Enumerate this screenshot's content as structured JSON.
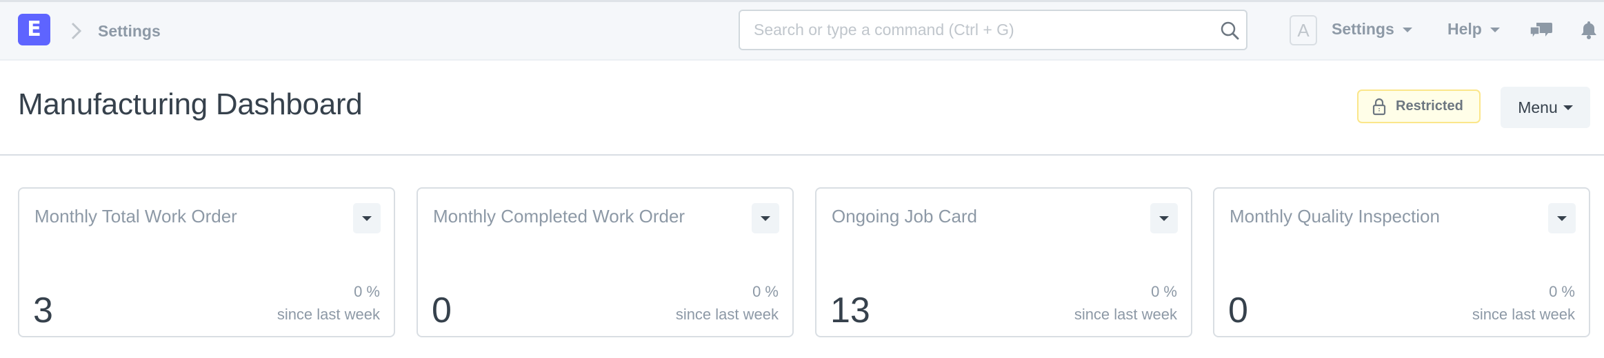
{
  "navbar": {
    "logo_letter": "E",
    "breadcrumb": "Settings",
    "search_placeholder": "Search or type a command (Ctrl + G)",
    "search_value": "",
    "avatar_letter": "A",
    "settings_label": "Settings",
    "help_label": "Help",
    "icons": [
      "chevron-right-icon",
      "search-icon",
      "chat-icon",
      "bell-icon"
    ]
  },
  "page": {
    "title": "Manufacturing Dashboard",
    "restricted_label": "Restricted",
    "menu_label": "Menu"
  },
  "cards": [
    {
      "title": "Monthly Total Work Order",
      "value": "3",
      "change": "0 %",
      "since": "since last week"
    },
    {
      "title": "Monthly Completed Work Order",
      "value": "0",
      "change": "0 %",
      "since": "since last week"
    },
    {
      "title": "Ongoing Job Card",
      "value": "13",
      "change": "0 %",
      "since": "since last week"
    },
    {
      "title": "Monthly Quality Inspection",
      "value": "0",
      "change": "0 %",
      "since": "since last week"
    }
  ],
  "colors": {
    "brand": "#5e64ff",
    "text_dark": "#36414c",
    "text_muted": "#8d99a6",
    "restricted_bg": "#fffee8",
    "restricted_border": "#fbe68a"
  }
}
